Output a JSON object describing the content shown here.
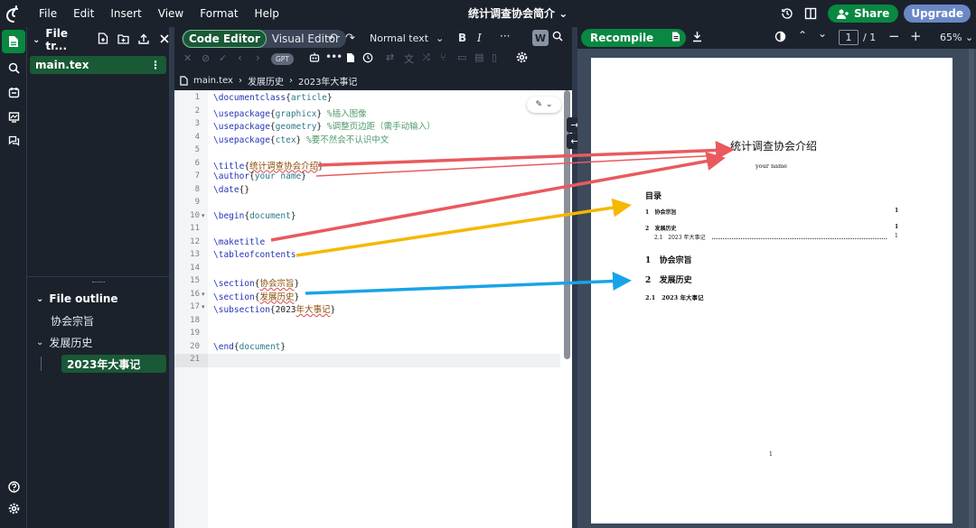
{
  "app": {
    "logo": "overleaf-logo",
    "menu": [
      "File",
      "Edit",
      "Insert",
      "View",
      "Format",
      "Help"
    ],
    "project_title": "统计调查协会简介",
    "share_label": "Share",
    "upgrade_label": "Upgrade"
  },
  "file_tree": {
    "title": "File tr...",
    "files": [
      {
        "name": "main.tex",
        "active": true
      }
    ]
  },
  "outline": {
    "title": "File outline",
    "items": [
      {
        "label": "协会宗旨",
        "level": 1
      },
      {
        "label": "发展历史",
        "level": 1,
        "expanded": true
      },
      {
        "label": "2023年大事记",
        "level": 2,
        "selected": true
      }
    ]
  },
  "editor": {
    "mode_toggle": {
      "code": "Code Editor",
      "visual": "Visual Editor",
      "active": "code"
    },
    "text_style": "Normal text",
    "gpt_badge": "GPT",
    "breadcrumb": [
      "main.tex",
      "发展历史",
      "2023年大事记"
    ],
    "current_line": 21,
    "lines": [
      "\\documentclass{article}",
      "\\usepackage{graphicx} %插入图像",
      "\\usepackage{geometry} %调整页边距（需手动输入）",
      "\\usepackage{ctex} %要不然会不认识中文",
      "",
      "\\title{统计调查协会介绍}",
      "\\author{your name}",
      "\\date{}",
      "",
      "\\begin{document}",
      "",
      "\\maketitle",
      "\\tableofcontents",
      "",
      "\\section{协会宗旨}",
      "\\section{发展历史}",
      "\\subsection{2023年大事记}",
      "",
      "",
      "\\end{document}",
      ""
    ]
  },
  "pdf": {
    "recompile_label": "Recompile",
    "page_input": "1",
    "page_total": "/ 1",
    "zoom": "65%",
    "title": "统计调查协会介绍",
    "author": "your name",
    "toc_heading": "目录",
    "toc": [
      {
        "num": "1",
        "label": "协会宗旨",
        "page": "1"
      },
      {
        "num": "2",
        "label": "发展历史",
        "page": "1"
      },
      {
        "num": "2.1",
        "label": "2023 年大事记",
        "page": "1"
      }
    ],
    "sections": [
      {
        "num": "1",
        "label": "协会宗旨"
      },
      {
        "num": "2",
        "label": "发展历史"
      },
      {
        "num": "2.1",
        "label": "2023 年大事记"
      }
    ],
    "footer_page": "1"
  },
  "annotation_colors": {
    "red": "#e85a5e",
    "yellow": "#f5b800",
    "blue": "#1aa3e8"
  }
}
